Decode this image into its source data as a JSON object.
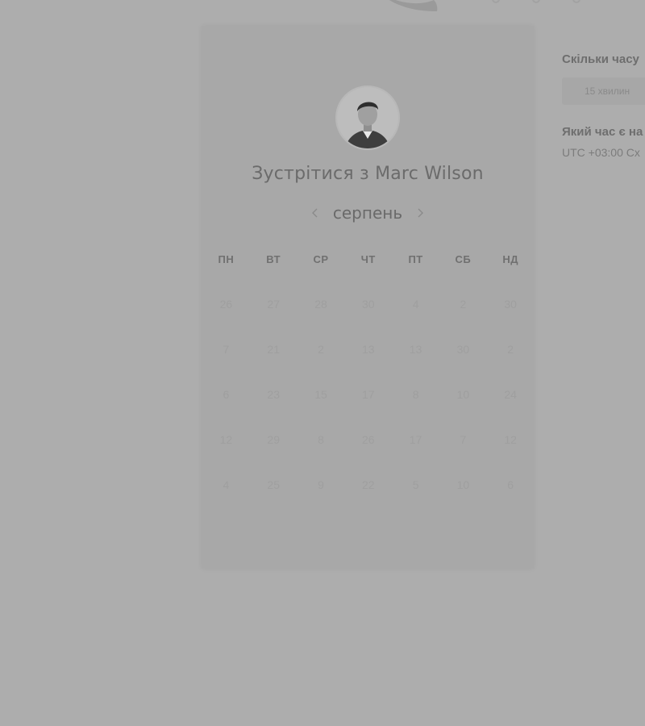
{
  "header": {
    "logo_icon": "brand-logo-blob"
  },
  "host": {
    "avatar_icon": "host-avatar",
    "title": "Зустрітися з Marc Wilson"
  },
  "calendar": {
    "month": "серпень",
    "prev_icon": "chevron-left-icon",
    "next_icon": "chevron-right-icon",
    "weekdays": [
      "ПН",
      "ВТ",
      "СР",
      "ЧТ",
      "ПТ",
      "СБ",
      "НД"
    ],
    "weeks": [
      [
        "26",
        "27",
        "28",
        "30",
        "4",
        "2",
        "30"
      ],
      [
        "7",
        "21",
        "2",
        "13",
        "13",
        "30",
        "2"
      ],
      [
        "6",
        "23",
        "15",
        "17",
        "8",
        "10",
        "24"
      ],
      [
        "12",
        "29",
        "8",
        "26",
        "17",
        "7",
        "12"
      ],
      [
        "4",
        "25",
        "9",
        "22",
        "5",
        "10",
        "6"
      ]
    ]
  },
  "side": {
    "duration_question": "Скільки часу",
    "duration_value": "15 хвилин",
    "timezone_question": "Який час є на",
    "timezone_value": "UTC +03:00 Сх"
  },
  "colors": {
    "background": "#adadad",
    "card": "#a8a8a8",
    "text_dark": "#6b6b6b"
  }
}
